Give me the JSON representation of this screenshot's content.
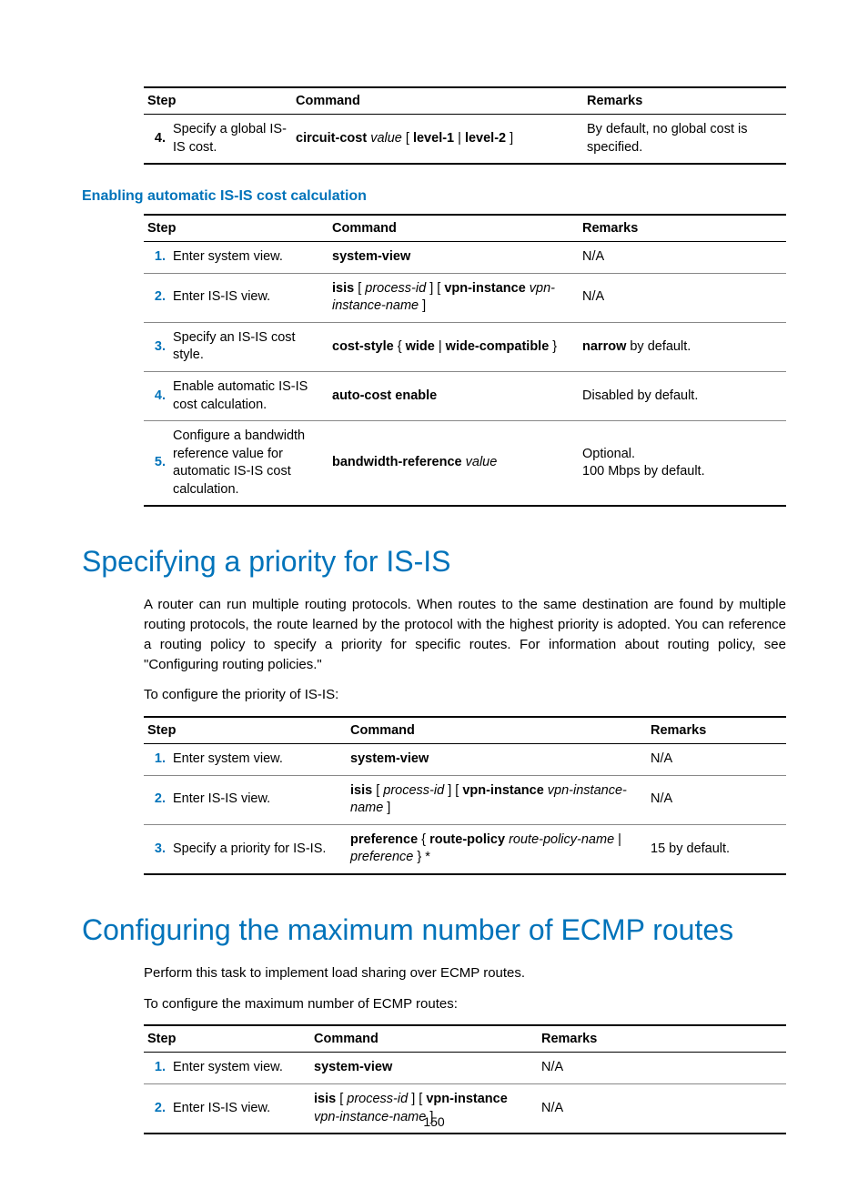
{
  "headers": {
    "step": "Step",
    "command": "Command",
    "remarks": "Remarks"
  },
  "table1": {
    "rows": [
      {
        "num": "4.",
        "step": "Specify a global IS-IS cost.",
        "cmd": "<span class='b'>circuit-cost</span> <span class='i'>value</span> [ <span class='b'>level-1</span> | <span class='b'>level-2</span> ]",
        "remarks": "By default, no global cost is specified."
      }
    ]
  },
  "section1_title": "Enabling automatic IS-IS cost calculation",
  "table2": {
    "rows": [
      {
        "num": "1.",
        "step": "Enter system view.",
        "cmd": "<span class='b'>system-view</span>",
        "remarks": "N/A"
      },
      {
        "num": "2.",
        "step": "Enter IS-IS view.",
        "cmd": "<span class='b'>isis</span> [ <span class='i'>process-id</span> ] [ <span class='b'>vpn-instance</span> <span class='i'>vpn-instance-name</span> ]",
        "remarks": "N/A"
      },
      {
        "num": "3.",
        "step": "Specify an IS-IS cost style.",
        "cmd": "<span class='b'>cost-style</span> { <span class='b'>wide</span> | <span class='b'>wide-compatible</span> }",
        "remarks": "<span class='b'>narrow</span> by default."
      },
      {
        "num": "4.",
        "step": "Enable automatic IS-IS cost calculation.",
        "cmd": "<span class='b'>auto-cost enable</span>",
        "remarks": "Disabled by default."
      },
      {
        "num": "5.",
        "step": "Configure a bandwidth reference value for automatic IS-IS cost calculation.",
        "cmd": "<span class='b'>bandwidth-reference</span> <span class='i'>value</span>",
        "remarks": "Optional.<br>100 Mbps by default."
      }
    ]
  },
  "h1a": "Specifying a priority for IS-IS",
  "para1": "A router can run multiple routing protocols. When routes to the same destination are found by multiple routing protocols, the route learned by the protocol with the highest priority is adopted. You can reference a routing policy to specify a priority for specific routes. For information about routing policy, see \"Configuring routing policies.\"",
  "para2": "To configure the priority of IS-IS:",
  "table3": {
    "rows": [
      {
        "num": "1.",
        "step": "Enter system view.",
        "cmd": "<span class='b'>system-view</span>",
        "remarks": "N/A"
      },
      {
        "num": "2.",
        "step": "Enter IS-IS view.",
        "cmd": "<span class='b'>isis</span> [ <span class='i'>process-id</span> ] [ <span class='b'>vpn-instance</span> <span class='i'>vpn-instance-name</span> ]",
        "remarks": "N/A"
      },
      {
        "num": "3.",
        "step": "Specify a priority for IS-IS.",
        "cmd": "<span class='b'>preference</span> { <span class='b'>route-policy</span> <span class='i'>route-policy-name</span> | <span class='i'>preference</span> } *",
        "remarks": "15 by default."
      }
    ]
  },
  "h1b": "Configuring the maximum number of ECMP routes",
  "para3": "Perform this task to implement load sharing over ECMP routes.",
  "para4": "To configure the maximum number of ECMP routes:",
  "table4": {
    "rows": [
      {
        "num": "1.",
        "step": "Enter system view.",
        "cmd": "<span class='b'>system-view</span>",
        "remarks": "N/A"
      },
      {
        "num": "2.",
        "step": "Enter IS-IS view.",
        "cmd": "<span class='b'>isis</span> [ <span class='i'>process-id</span> ] [ <span class='b'>vpn-instance</span> <span class='i'>vpn-instance-name</span> ]",
        "remarks": "N/A"
      }
    ]
  },
  "pagenum": "150"
}
